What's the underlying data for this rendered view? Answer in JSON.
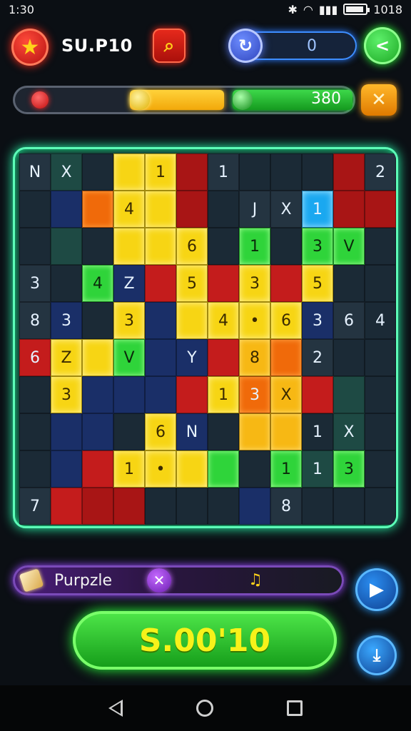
{
  "status_bar": {
    "time": "1:30",
    "battery": "1018",
    "icons": [
      "bluetooth-icon",
      "wifi-icon",
      "signal-icon",
      "battery-icon"
    ]
  },
  "header": {
    "title": "SU.P10",
    "score": "0"
  },
  "progress": {
    "value": "380"
  },
  "board": {
    "rows": [
      [
        {
          "t": "N",
          "c": "c-d"
        },
        {
          "t": "X",
          "c": "c-teal"
        },
        {
          "t": "",
          "c": "c-d2"
        },
        {
          "t": "",
          "c": "c-yel"
        },
        {
          "t": "1",
          "c": "c-yel"
        },
        {
          "t": "",
          "c": "c-dred"
        },
        {
          "t": "1",
          "c": "c-d"
        },
        {
          "t": "",
          "c": "c-d2"
        },
        {
          "t": "",
          "c": "c-d2"
        },
        {
          "t": "",
          "c": "c-d2"
        },
        {
          "t": "",
          "c": "c-dred"
        },
        {
          "t": "2",
          "c": "c-d"
        }
      ],
      [
        {
          "t": "",
          "c": "c-d2"
        },
        {
          "t": "",
          "c": "c-navy"
        },
        {
          "t": "",
          "c": "c-org"
        },
        {
          "t": "4",
          "c": "c-yel"
        },
        {
          "t": "",
          "c": "c-yel"
        },
        {
          "t": "",
          "c": "c-dred"
        },
        {
          "t": "",
          "c": "c-d2"
        },
        {
          "t": "J",
          "c": "c-d"
        },
        {
          "t": "X",
          "c": "c-d"
        },
        {
          "t": "1",
          "c": "c-blu"
        },
        {
          "t": "",
          "c": "c-dred"
        },
        {
          "t": "",
          "c": "c-dred"
        }
      ],
      [
        {
          "t": "",
          "c": "c-d2"
        },
        {
          "t": "",
          "c": "c-teal"
        },
        {
          "t": "",
          "c": "c-d2"
        },
        {
          "t": "",
          "c": "c-yel"
        },
        {
          "t": "",
          "c": "c-yel"
        },
        {
          "t": "6",
          "c": "c-yel"
        },
        {
          "t": "",
          "c": "c-d2"
        },
        {
          "t": "1",
          "c": "c-lg"
        },
        {
          "t": "",
          "c": "c-d2"
        },
        {
          "t": "3",
          "c": "c-lg"
        },
        {
          "t": "V",
          "c": "c-lg"
        },
        {
          "t": "",
          "c": "c-d2"
        }
      ],
      [
        {
          "t": "3",
          "c": "c-d"
        },
        {
          "t": "",
          "c": "c-d2"
        },
        {
          "t": "4",
          "c": "c-lg"
        },
        {
          "t": "Z",
          "c": "c-navy"
        },
        {
          "t": "",
          "c": "c-red"
        },
        {
          "t": "5",
          "c": "c-yel"
        },
        {
          "t": "",
          "c": "c-red"
        },
        {
          "t": "3",
          "c": "c-yel"
        },
        {
          "t": "",
          "c": "c-red"
        },
        {
          "t": "5",
          "c": "c-yel"
        },
        {
          "t": "",
          "c": "c-d2"
        },
        {
          "t": "",
          "c": "c-d2"
        }
      ],
      [
        {
          "t": "8",
          "c": "c-d"
        },
        {
          "t": "3",
          "c": "c-navy"
        },
        {
          "t": "",
          "c": "c-d2"
        },
        {
          "t": "3",
          "c": "c-yel"
        },
        {
          "t": "",
          "c": "c-navy"
        },
        {
          "t": "",
          "c": "c-yel"
        },
        {
          "t": "4",
          "c": "c-yel"
        },
        {
          "t": "•",
          "c": "c-yel"
        },
        {
          "t": "6",
          "c": "c-yel"
        },
        {
          "t": "3",
          "c": "c-navy"
        },
        {
          "t": "6",
          "c": "c-d"
        },
        {
          "t": "4",
          "c": "c-d2"
        }
      ],
      [
        {
          "t": "6",
          "c": "c-red"
        },
        {
          "t": "Z",
          "c": "c-yel"
        },
        {
          "t": "",
          "c": "c-yel"
        },
        {
          "t": "V",
          "c": "c-lg"
        },
        {
          "t": "",
          "c": "c-navy"
        },
        {
          "t": "Y",
          "c": "c-navy"
        },
        {
          "t": "",
          "c": "c-red"
        },
        {
          "t": "8",
          "c": "c-yel2"
        },
        {
          "t": "",
          "c": "c-org"
        },
        {
          "t": "2",
          "c": "c-d"
        },
        {
          "t": "",
          "c": "c-d2"
        },
        {
          "t": "",
          "c": "c-d2"
        }
      ],
      [
        {
          "t": "",
          "c": "c-d2"
        },
        {
          "t": "3",
          "c": "c-yel"
        },
        {
          "t": "",
          "c": "c-navy"
        },
        {
          "t": "",
          "c": "c-navy"
        },
        {
          "t": "",
          "c": "c-navy"
        },
        {
          "t": "",
          "c": "c-red"
        },
        {
          "t": "1",
          "c": "c-yel"
        },
        {
          "t": "3",
          "c": "c-org"
        },
        {
          "t": "X",
          "c": "c-yel2"
        },
        {
          "t": "",
          "c": "c-red"
        },
        {
          "t": "",
          "c": "c-teal"
        },
        {
          "t": "",
          "c": "c-d2"
        }
      ],
      [
        {
          "t": "",
          "c": "c-d2"
        },
        {
          "t": "",
          "c": "c-navy"
        },
        {
          "t": "",
          "c": "c-navy"
        },
        {
          "t": "",
          "c": "c-d2"
        },
        {
          "t": "6",
          "c": "c-yel"
        },
        {
          "t": "N",
          "c": "c-navy"
        },
        {
          "t": "",
          "c": "c-d2"
        },
        {
          "t": "",
          "c": "c-yel2"
        },
        {
          "t": "",
          "c": "c-yel2"
        },
        {
          "t": "1",
          "c": "c-d2"
        },
        {
          "t": "X",
          "c": "c-teal"
        },
        {
          "t": "",
          "c": "c-d2"
        }
      ],
      [
        {
          "t": "",
          "c": "c-d2"
        },
        {
          "t": "",
          "c": "c-navy"
        },
        {
          "t": "",
          "c": "c-red"
        },
        {
          "t": "1",
          "c": "c-yel"
        },
        {
          "t": "•",
          "c": "c-yel"
        },
        {
          "t": "",
          "c": "c-yel"
        },
        {
          "t": "",
          "c": "c-lg"
        },
        {
          "t": "",
          "c": "c-d2"
        },
        {
          "t": "1",
          "c": "c-lg"
        },
        {
          "t": "1",
          "c": "c-teal"
        },
        {
          "t": "3",
          "c": "c-lg"
        },
        {
          "t": "",
          "c": "c-d2"
        }
      ],
      [
        {
          "t": "7",
          "c": "c-d"
        },
        {
          "t": "",
          "c": "c-red"
        },
        {
          "t": "",
          "c": "c-dred"
        },
        {
          "t": "",
          "c": "c-dred"
        },
        {
          "t": "",
          "c": "c-d2"
        },
        {
          "t": "",
          "c": "c-d2"
        },
        {
          "t": "",
          "c": "c-d2"
        },
        {
          "t": "",
          "c": "c-navy"
        },
        {
          "t": "8",
          "c": "c-d"
        },
        {
          "t": "",
          "c": "c-d2"
        },
        {
          "t": "",
          "c": "c-d2"
        },
        {
          "t": "",
          "c": "c-d2"
        }
      ]
    ]
  },
  "word_bar": {
    "label": "Purpzle",
    "value": "♫"
  },
  "action": {
    "label": "S.00'10"
  },
  "colors": {
    "accent_green": "#2aff3a",
    "board_glow": "#5dffb8",
    "purple": "#9a4aff"
  }
}
